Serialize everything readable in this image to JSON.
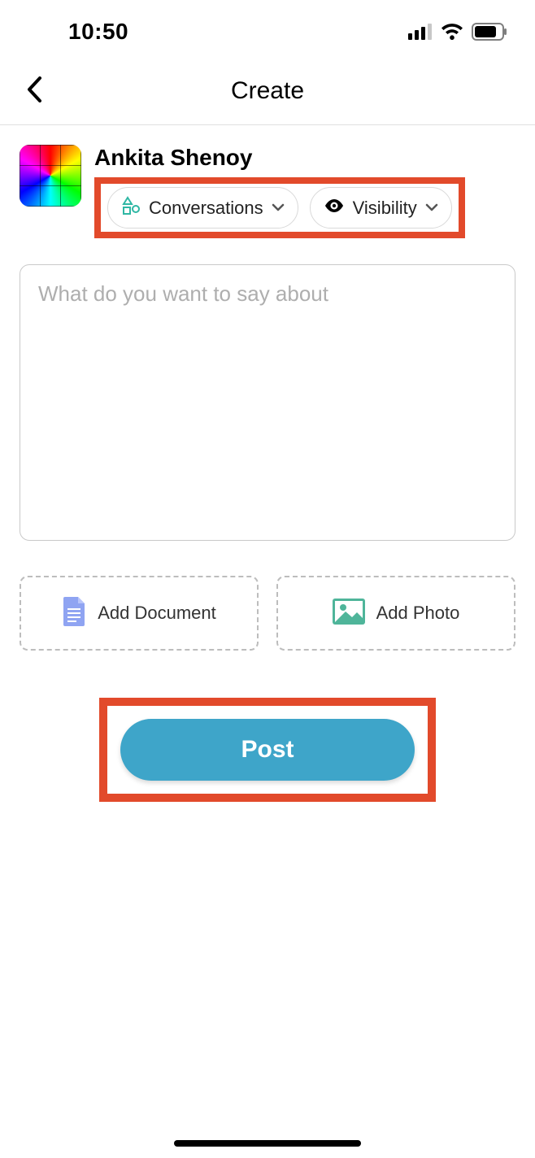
{
  "status": {
    "time": "10:50"
  },
  "header": {
    "title": "Create"
  },
  "author": {
    "name": "Ankita Shenoy"
  },
  "selectors": {
    "conversations": {
      "label": "Conversations"
    },
    "visibility": {
      "label": "Visibility"
    }
  },
  "compose": {
    "placeholder": "What do you want to say about"
  },
  "attachments": {
    "document": {
      "label": "Add Document"
    },
    "photo": {
      "label": "Add Photo"
    }
  },
  "post": {
    "label": "Post"
  }
}
